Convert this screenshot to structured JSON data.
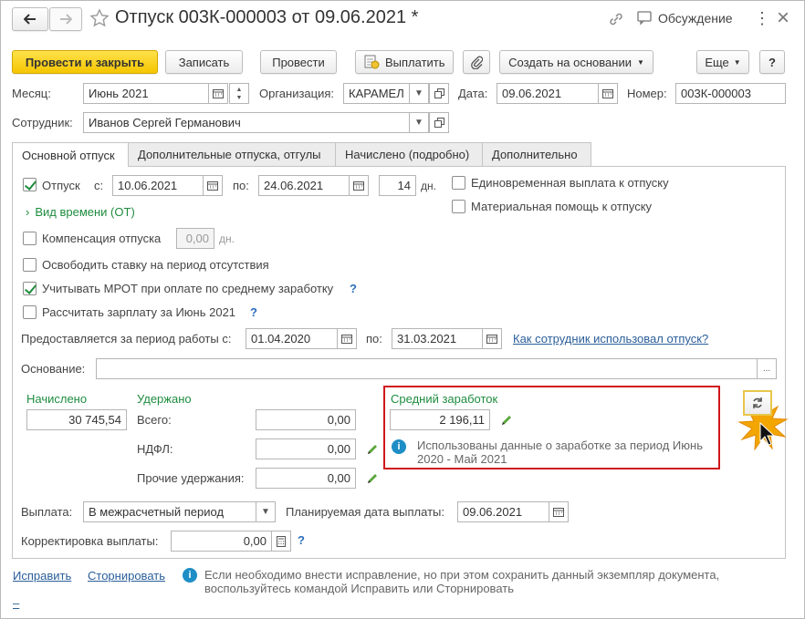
{
  "window": {
    "title": "Отпуск 003К-000003 от 09.06.2021 *",
    "discussion_label": "Обсуждение",
    "more_symbol": "⋮",
    "close_symbol": "×"
  },
  "toolbar": {
    "post_close": "Провести и закрыть",
    "save": "Записать",
    "post": "Провести",
    "pay": "Выплатить",
    "create_based": "Создать на основании",
    "more": "Еще",
    "help": "?"
  },
  "header": {
    "month_label": "Месяц:",
    "month_value": "Июнь 2021",
    "org_label": "Организация:",
    "org_value": "КАРАМЕЛ",
    "date_label": "Дата:",
    "date_value": "09.06.2021",
    "number_label": "Номер:",
    "number_value": "003К-000003",
    "employee_label": "Сотрудник:",
    "employee_value": "Иванов Сергей Германович"
  },
  "tabs": [
    {
      "label": "Основной отпуск",
      "active": true
    },
    {
      "label": "Дополнительные отпуска, отгулы",
      "active": false
    },
    {
      "label": "Начислено (подробно)",
      "active": false
    },
    {
      "label": "Дополнительно",
      "active": false
    }
  ],
  "main": {
    "vacation_label": "Отпуск",
    "vacation_checked": true,
    "from_label": "с:",
    "from_value": "10.06.2021",
    "to_label": "по:",
    "to_value": "24.06.2021",
    "days_value": "14",
    "days_unit": "дн.",
    "lump_sum_label": "Единовременная выплата к отпуску",
    "material_aid_label": "Материальная помощь к отпуску",
    "time_type_label": "Вид времени (ОТ)",
    "compensation_label": "Компенсация отпуска",
    "compensation_value": "0,00",
    "compensation_unit": "дн.",
    "release_rate_label": "Освободить ставку на период отсутствия",
    "mrot_label": "Учитывать МРОТ при оплате по среднему заработку",
    "mrot_checked": true,
    "calc_salary_label": "Рассчитать зарплату за Июнь 2021",
    "period_label": "Предоставляется за период работы с:",
    "period_from": "01.04.2020",
    "period_to_label": "по:",
    "period_to": "31.03.2021",
    "usage_link": "Как сотрудник использовал отпуск?",
    "basis_label": "Основание:",
    "basis_value": "",
    "basis_btn": "..."
  },
  "amounts": {
    "accrued_label": "Начислено",
    "accrued_value": "30 745,54",
    "withheld_label": "Удержано",
    "total_label": "Всего:",
    "total_value": "0,00",
    "ndfl_label": "НДФЛ:",
    "ndfl_value": "0,00",
    "other_label": "Прочие удержания:",
    "other_value": "0,00",
    "avg_label": "Средний заработок",
    "avg_value": "2 196,11",
    "avg_info": "Использованы данные о заработке за период Июнь 2020 - Май 2021"
  },
  "payment": {
    "payout_label": "Выплата:",
    "payout_value": "В межрасчетный период",
    "planned_label": "Планируемая дата выплаты:",
    "planned_value": "09.06.2021",
    "correction_label": "Корректировка выплаты:",
    "correction_value": "0,00"
  },
  "footer": {
    "fix_link": "Исправить",
    "reverse_link": "Сторнировать",
    "info_text_1": "Если необходимо внести исправление, но при этом сохранить данный экземпляр документа,",
    "info_text_2": "воспользуйтесь командой Исправить или Сторнировать",
    "dash": "–"
  },
  "colors": {
    "primary_button": "#f5c600",
    "green_text": "#1e8c3f",
    "link": "#2a5e99",
    "highlight_border": "#d0161b",
    "info_icon": "#1d8ec6"
  }
}
